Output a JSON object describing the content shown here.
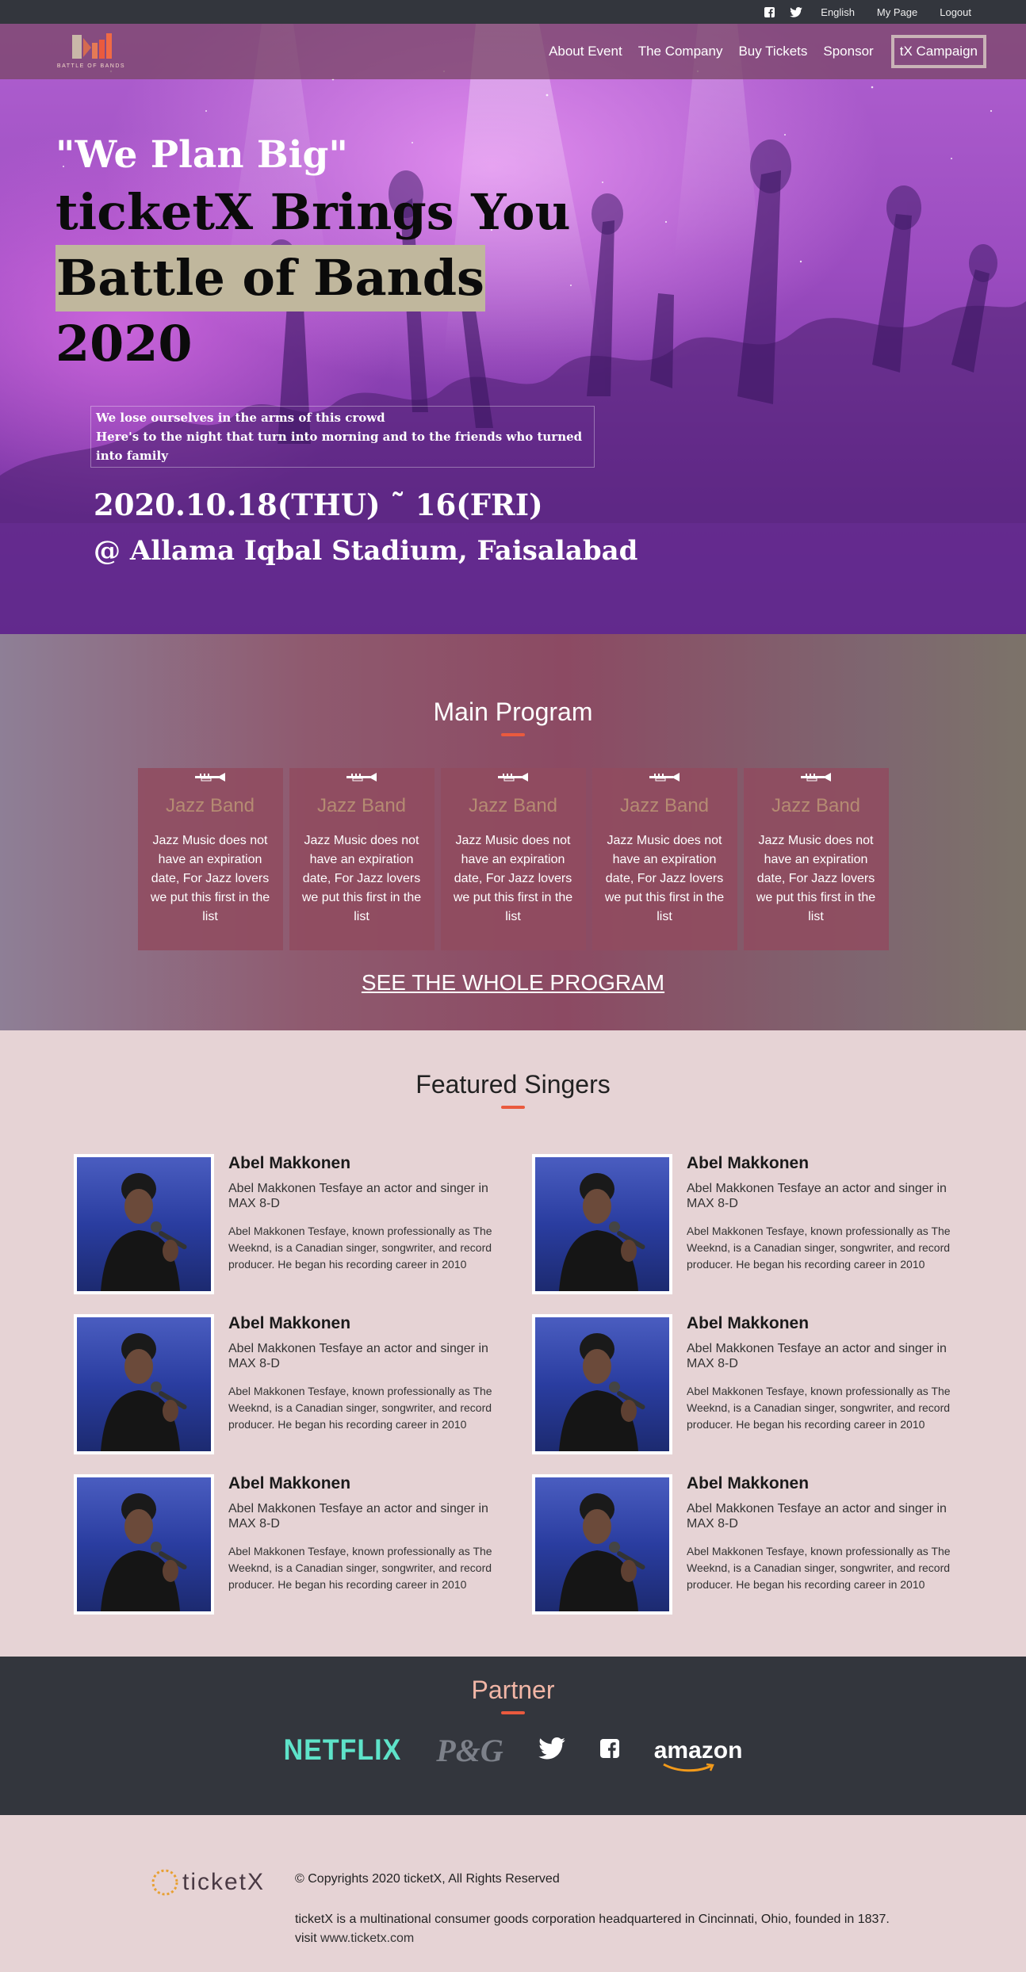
{
  "topbar": {
    "icons": [
      "facebook-icon",
      "twitter-icon"
    ],
    "links": [
      "English",
      "My Page",
      "Logout"
    ]
  },
  "nav": {
    "logo_text": "BATTLE OF BANDS",
    "links": [
      "About Event",
      "The Company",
      "Buy Tickets",
      "Sponsor"
    ],
    "campaign": "tX Campaign"
  },
  "hero": {
    "quote": "\"We Plan Big\"",
    "line1": "ticketX Brings You",
    "line2": "Battle of Bands",
    "line3": "2020",
    "sub1": "We lose ourselves in the arms of this crowd",
    "sub2": "Here's to the night that turn into morning and to the friends who turned into family",
    "date": "2020.10.18(THU) ˜ 16(FRI)",
    "place": "@ Allama Iqbal Stadium, Faisalabad"
  },
  "program": {
    "title": "Main Program",
    "cards": [
      {
        "title": "Jazz Band",
        "desc": "Jazz Music does not have an expiration date, For Jazz lovers we put this first in the list"
      },
      {
        "title": "Jazz Band",
        "desc": "Jazz Music does not have an expiration date, For Jazz lovers we put this first in the list"
      },
      {
        "title": "Jazz Band",
        "desc": "Jazz Music does not have an expiration date, For Jazz lovers we put this first in the list"
      },
      {
        "title": "Jazz Band",
        "desc": "Jazz Music does not have an expiration date, For Jazz lovers we put this first in the list"
      },
      {
        "title": "Jazz Band",
        "desc": "Jazz Music does not have an expiration date, For Jazz lovers we put this first in the list"
      }
    ],
    "see_all": "SEE THE WHOLE PROGRAM"
  },
  "singers": {
    "title": "Featured Singers",
    "items": [
      {
        "name": "Abel Makkonen",
        "role": "Abel Makkonen Tesfaye an actor and singer in MAX 8-D",
        "bio": "Abel Makkonen Tesfaye, known professionally as The Weeknd, is a Canadian singer, songwriter, and record producer. He began his recording career in 2010"
      },
      {
        "name": "Abel Makkonen",
        "role": "Abel Makkonen Tesfaye an actor and singer in MAX 8-D",
        "bio": "Abel Makkonen Tesfaye, known professionally as The Weeknd, is a Canadian singer, songwriter, and record producer. He began his recording career in 2010"
      },
      {
        "name": "Abel Makkonen",
        "role": "Abel Makkonen Tesfaye an actor and singer in MAX 8-D",
        "bio": "Abel Makkonen Tesfaye, known professionally as The Weeknd, is a Canadian singer, songwriter, and record producer. He began his recording career in 2010"
      },
      {
        "name": "Abel Makkonen",
        "role": "Abel Makkonen Tesfaye an actor and singer in MAX 8-D",
        "bio": "Abel Makkonen Tesfaye, known professionally as The Weeknd, is a Canadian singer, songwriter, and record producer. He began his recording career in 2010"
      },
      {
        "name": "Abel Makkonen",
        "role": "Abel Makkonen Tesfaye an actor and singer in MAX 8-D",
        "bio": "Abel Makkonen Tesfaye, known professionally as The Weeknd, is a Canadian singer, songwriter, and record producer. He began his recording career in 2010"
      },
      {
        "name": "Abel Makkonen",
        "role": "Abel Makkonen Tesfaye an actor and singer in MAX 8-D",
        "bio": "Abel Makkonen Tesfaye, known professionally as The Weeknd, is a Canadian singer, songwriter, and record producer. He began his recording career in 2010"
      }
    ]
  },
  "partner": {
    "title": "Partner",
    "logos": [
      "NETFLIX",
      "P&G",
      "twitter-icon",
      "facebook-icon",
      "amazon"
    ]
  },
  "footer": {
    "logo_text": "ticketX",
    "copyright": "© Copyrights 2020 ticketX, All Rights Reserved",
    "about": "ticketX is a multinational consumer goods corporation headquartered in Cincinnati, Ohio, founded in 1837.",
    "visit_label": "visit",
    "visit_link": "www.ticketx.com"
  },
  "colors": {
    "topbar": "#33363d",
    "accent": "#ea5a3e",
    "highlight": "#c0b79d",
    "page_bg": "#e6d3d5",
    "netflix": "#5ee3c9"
  }
}
